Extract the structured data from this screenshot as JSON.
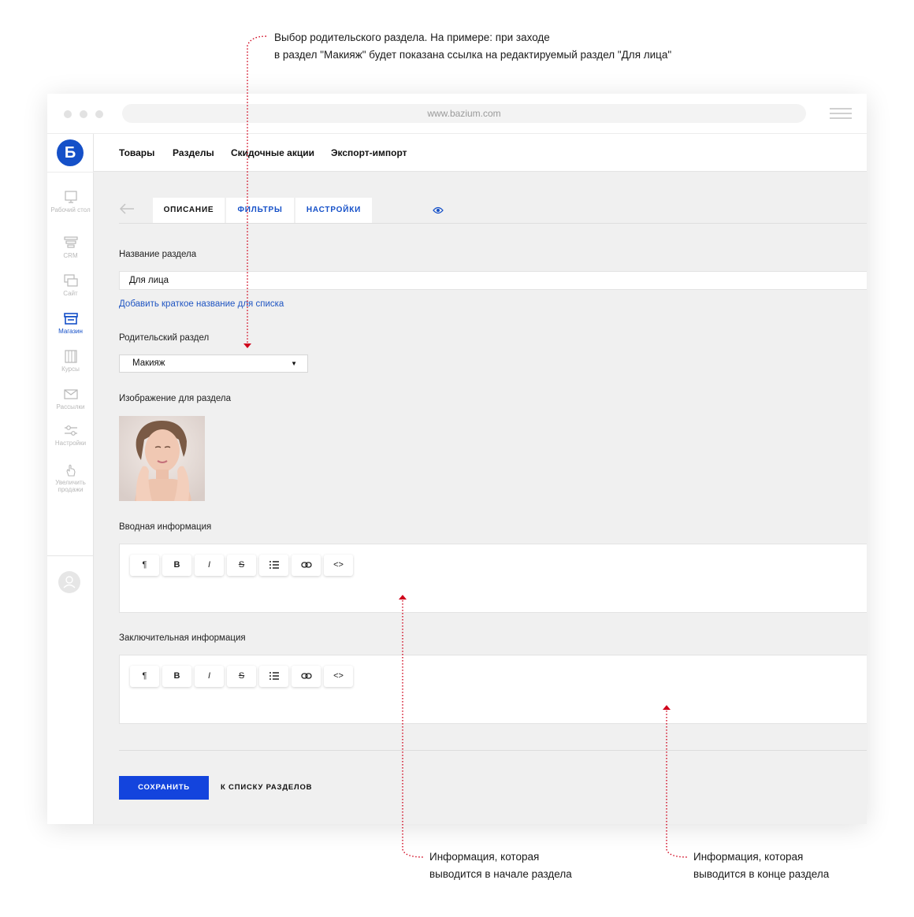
{
  "annotations": {
    "parent_line1": "Выбор родительского раздела. На примере: при заходе",
    "parent_line2": "в раздел \"Макияж\" будет показана ссылка на редактируемый раздел \"Для лица\"",
    "intro_line1": "Информация, которая",
    "intro_line2": "выводится в начале раздела",
    "outro_line1": "Информация, которая",
    "outro_line2": "выводится в конце раздела",
    "line_color": "#d0021b"
  },
  "browser": {
    "url": "www.bazium.com"
  },
  "sidebar": {
    "logo": "Б",
    "items": [
      {
        "label": "Рабочий стол",
        "icon": "monitor-icon",
        "active": false
      },
      {
        "label": "CRM",
        "icon": "funnel-icon",
        "active": false
      },
      {
        "label": "Сайт",
        "icon": "windows-icon",
        "active": false
      },
      {
        "label": "Магазин",
        "icon": "store-icon",
        "active": true
      },
      {
        "label": "Курсы",
        "icon": "books-icon",
        "active": false
      },
      {
        "label": "Рассылки",
        "icon": "envelope-icon",
        "active": false
      },
      {
        "label": "Настройки",
        "icon": "sliders-icon",
        "active": false
      },
      {
        "label": "Увеличить продажи",
        "icon": "hand-icon",
        "active": false
      }
    ]
  },
  "topnav": [
    "Товары",
    "Разделы",
    "Скидочные акции",
    "Экспорт-импорт"
  ],
  "tabs": [
    "ОПИСАНИЕ",
    "ФИЛЬТРЫ",
    "НАСТРОЙКИ"
  ],
  "form": {
    "name_label": "Название раздела",
    "name_value": "Для лица",
    "short_name_link": "Добавить краткое название для списка",
    "parent_label": "Родительский раздел",
    "parent_value": "Макияж",
    "image_label": "Изображение для раздела",
    "intro_label": "Вводная информация",
    "outro_label": "Заключительная информация",
    "toolbar": [
      "¶",
      "B",
      "I",
      "S",
      "list",
      "link",
      "<>"
    ]
  },
  "actions": {
    "save": "СОХРАНИТЬ",
    "back_to_list": "К СПИСКУ РАЗДЕЛОВ"
  },
  "colors": {
    "accent": "#1550c8",
    "save_button": "#1344dd",
    "background": "#f0f0f0"
  }
}
